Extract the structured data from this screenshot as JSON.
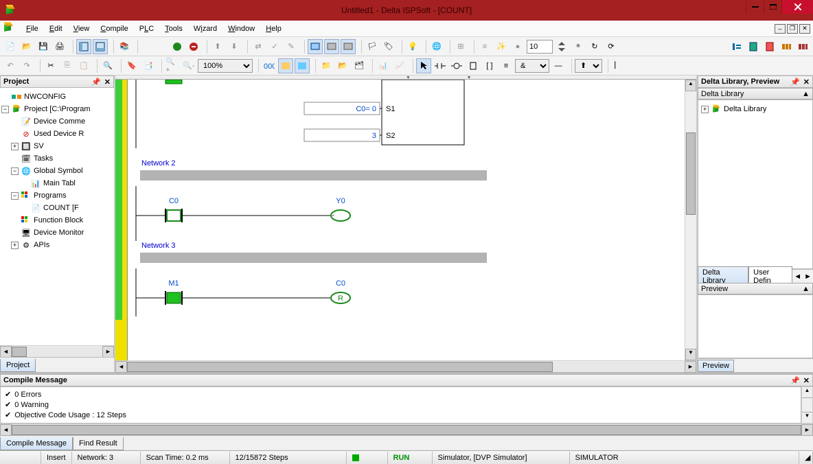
{
  "title": "Untitled1 - Delta ISPSoft - [COUNT]",
  "menus": [
    "File",
    "Edit",
    "View",
    "Compile",
    "PLC",
    "Tools",
    "Wizard",
    "Window",
    "Help"
  ],
  "toolbar2": {
    "zoom": "100%",
    "combo": "&"
  },
  "toolbar1": {
    "num": "10"
  },
  "project_panel": {
    "title": "Project",
    "tab": "Project",
    "nodes": {
      "nw": "NWCONFIG",
      "proj": "Project [C:\\Program",
      "dev_comm": "Device Comme",
      "used_dev": "Used Device R",
      "sv": "SV",
      "tasks": "Tasks",
      "gsym": "Global Symbol",
      "maint": "Main Tabl",
      "programs": "Programs",
      "count": "COUNT [F",
      "fblock": "Function Block",
      "dmon": "Device Monitor",
      "apis": "APIs"
    }
  },
  "ladder": {
    "s1_val": "C0= 0",
    "s1_lbl": "S1",
    "s2_val": "3",
    "s2_lbl": "S2",
    "net2": "Network 2",
    "c0": "C0",
    "y0": "Y0",
    "net3": "Network 3",
    "m1": "M1",
    "c0b": "C0",
    "r": "R"
  },
  "right": {
    "head": "Delta Library, Preview",
    "lib_head": "Delta Library",
    "lib_item": "Delta Library",
    "tab_lib": "Delta Library",
    "tab_user": "User Defin",
    "preview_head": "Preview",
    "preview_tab": "Preview"
  },
  "compile": {
    "head": "Compile Message",
    "lines": [
      "0 Errors",
      "0 Warning",
      "Objective Code Usage : 12 Steps"
    ],
    "tab1": "Compile Message",
    "tab2": "Find Result"
  },
  "status": {
    "mode": "Insert",
    "network": "Network: 3",
    "scan": "Scan Time: 0.2 ms",
    "steps": "12/15872 Steps",
    "run": "RUN",
    "sim": "Simulator, [DVP Simulator]",
    "simlabel": "SIMULATOR"
  }
}
